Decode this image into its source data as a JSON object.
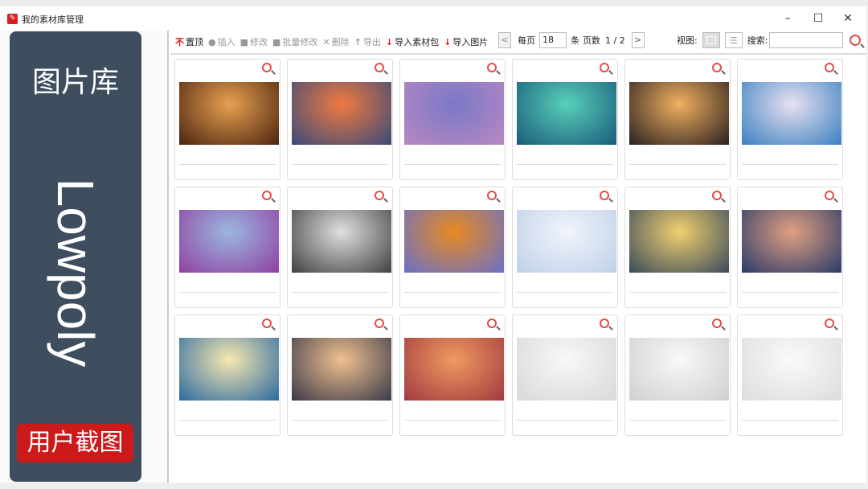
{
  "window": {
    "title": "我的素材库管理",
    "minimize": "–",
    "maximize": "☐",
    "close": "✕"
  },
  "toolbar": {
    "items": [
      {
        "icon": "pin-top-icon",
        "glyph": "不",
        "label": "置顶",
        "active": true,
        "red": true
      },
      {
        "icon": "insert-icon",
        "glyph": "●",
        "label": "插入",
        "active": false
      },
      {
        "icon": "edit-icon",
        "glyph": "■",
        "label": "修改",
        "active": false
      },
      {
        "icon": "batch-edit-icon",
        "glyph": "■",
        "label": "批量修改",
        "active": false
      },
      {
        "icon": "delete-icon",
        "glyph": "✕",
        "label": "删除",
        "active": false
      },
      {
        "icon": "export-icon",
        "glyph": "↑",
        "label": "导出",
        "active": false
      },
      {
        "icon": "import-package-icon",
        "glyph": "↓",
        "label": "导入素材包",
        "active": true,
        "red": true
      },
      {
        "icon": "import-image-icon",
        "glyph": "↓",
        "label": "导入图片",
        "active": true,
        "red": true
      }
    ]
  },
  "pager": {
    "prev": "<",
    "per_page_label": "每页",
    "per_page": "18",
    "unit": "条",
    "pages_label": "页数",
    "pages": "1 / 2",
    "next": ">"
  },
  "view": {
    "label": "视图:",
    "search_label": "搜索:",
    "search_value": ""
  },
  "thumbnails": [
    [
      "#e8a050",
      "#4a2410"
    ],
    [
      "#f07a40",
      "#3a4a7a"
    ],
    [
      "#7a78c8",
      "#b888c0"
    ],
    [
      "#58d0b8",
      "#1a5a7a"
    ],
    [
      "#f0b060",
      "#2a2020"
    ],
    [
      "#e8e0f0",
      "#3a80c0"
    ],
    [
      "#9ab8e0",
      "#9040a0"
    ],
    [
      "#e0e0e0",
      "#404040"
    ],
    [
      "#e88a20",
      "#6a70c8"
    ],
    [
      "#f0f4fa",
      "#c0d0e8"
    ],
    [
      "#f0d070",
      "#3a4a5a"
    ],
    [
      "#e0a080",
      "#2a3a6a"
    ],
    [
      "#f8e8b0",
      "#2a6aa0"
    ],
    [
      "#f0c090",
      "#3a3a48"
    ],
    [
      "#f09a60",
      "#a03a40"
    ],
    [
      "#f8f8f8",
      "#d8d8d8"
    ],
    [
      "#f8f8f8",
      "#d0d0d0"
    ],
    [
      "#fafafa",
      "#dcdcdc"
    ]
  ],
  "overlay": {
    "title": "图片库",
    "word": "Lowpoly",
    "badge": "用户截图"
  },
  "colors": {
    "accent": "#d81818",
    "overlay": "#3f4e5e",
    "badge": "#cc1a1a"
  }
}
